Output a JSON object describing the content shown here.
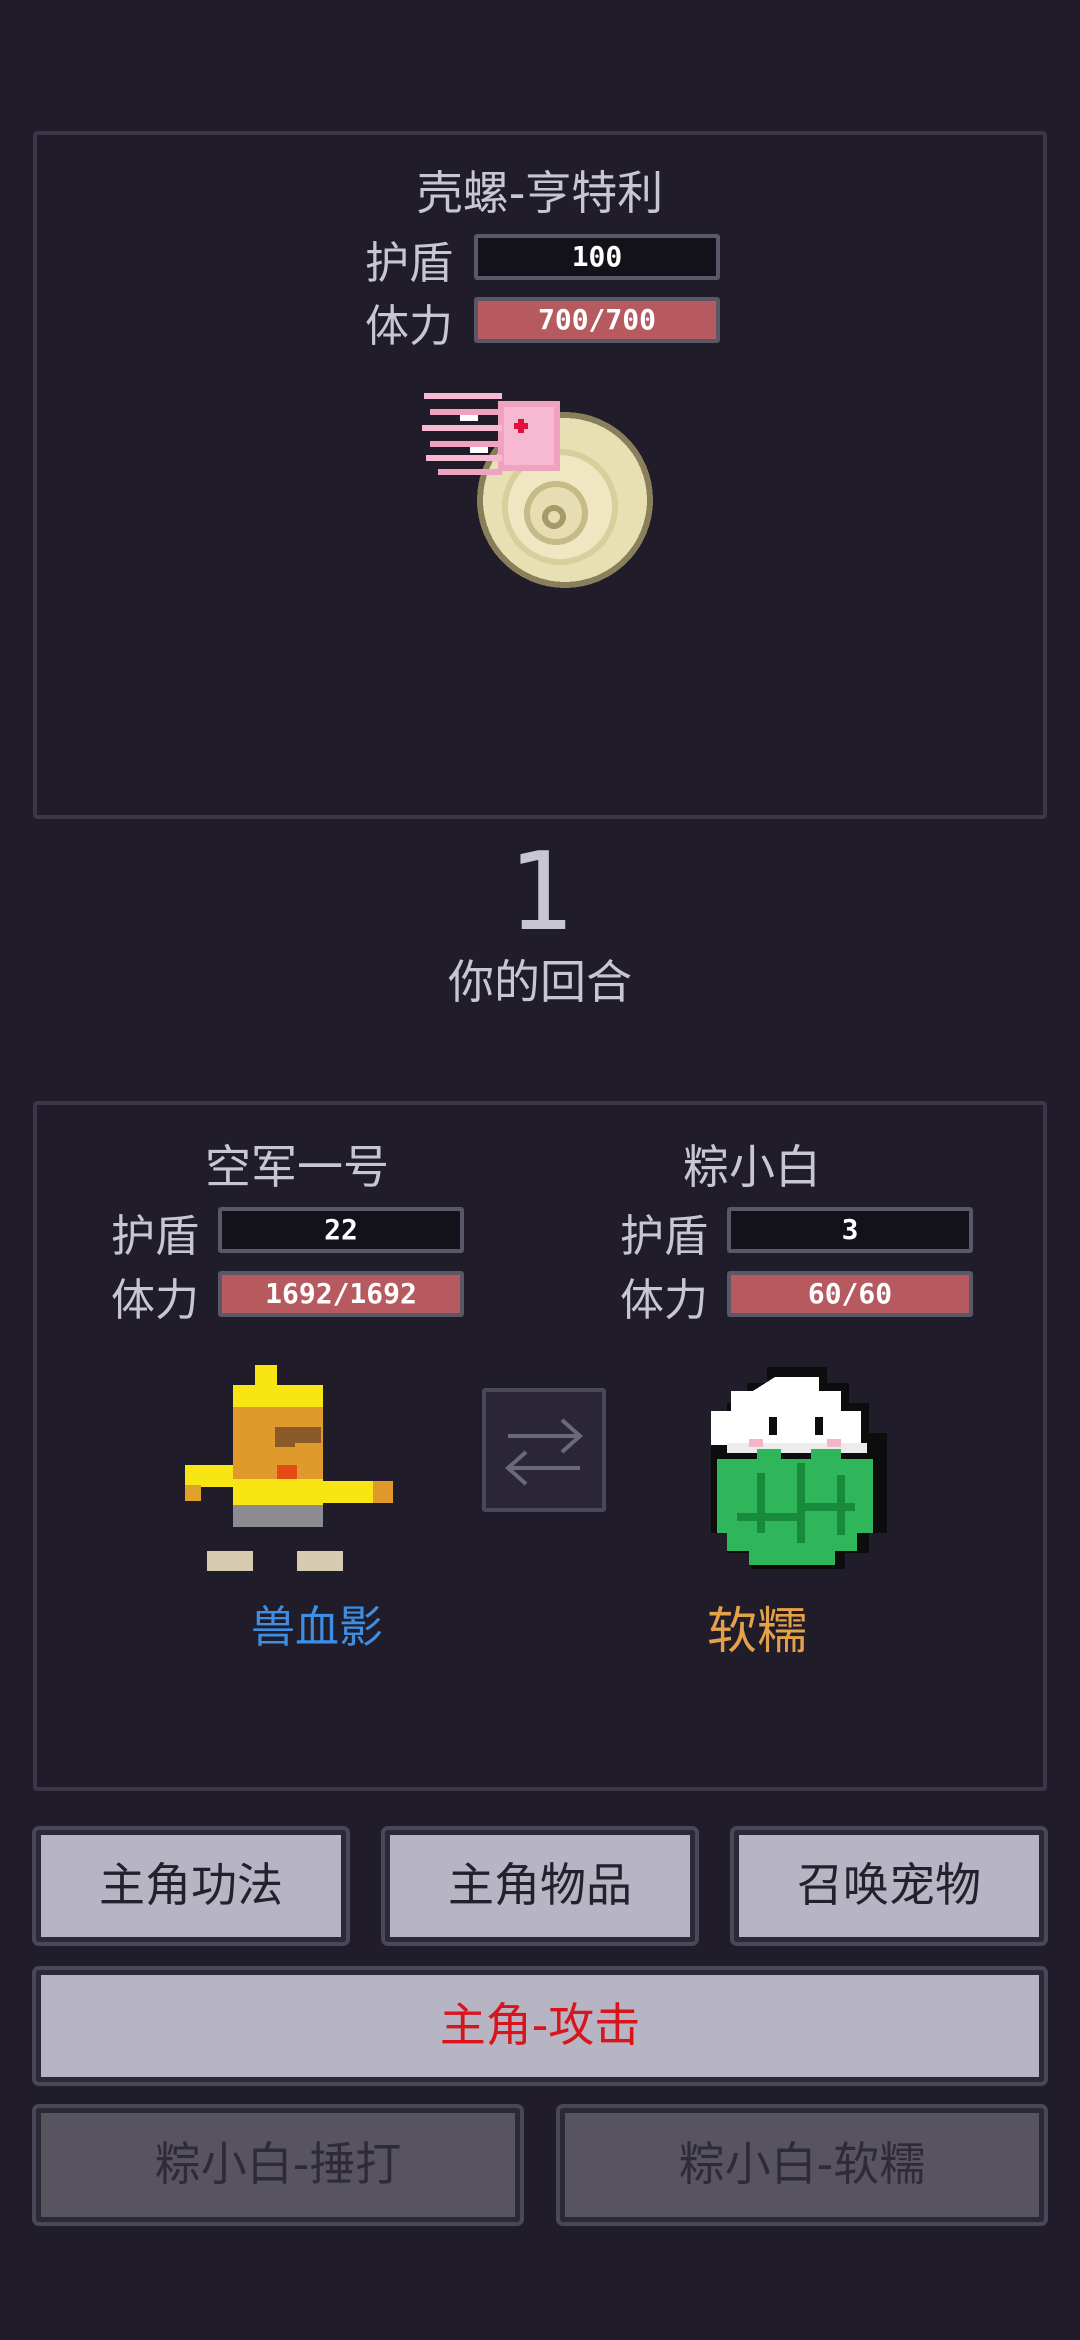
{
  "enemy": {
    "name": "壳螺-亨特利",
    "shield_label": "护盾",
    "shield_value": "100",
    "hp_label": "体力",
    "hp_text": "700/700",
    "hp_fraction": 1.0
  },
  "turn": {
    "number": "1",
    "label": "你的回合"
  },
  "hero": {
    "name": "空军一号",
    "shield_label": "护盾",
    "shield_value": "22",
    "hp_label": "体力",
    "hp_text": "1692/1692",
    "hp_fraction": 1.0,
    "skill": "兽血影",
    "skill_color": "#3e8ee3"
  },
  "pet": {
    "name": "粽小白",
    "shield_label": "护盾",
    "shield_value": "3",
    "hp_label": "体力",
    "hp_text": "60/60",
    "hp_fraction": 1.0,
    "skill": "软糯",
    "skill_color": "#e3a24a"
  },
  "swap_icon": "swap-arrows-icon",
  "actions": {
    "hero_skills": "主角功法",
    "hero_items": "主角物品",
    "summon_pet": "召唤宠物",
    "hero_attack": "主角-攻击",
    "hero_attack_color": "#d8141d",
    "pet_hit": "粽小白-捶打",
    "pet_soft": "粽小白-软糯"
  },
  "colors": {
    "background": "#201c29",
    "hp_bar": "#b75a60",
    "shield_bar": "#13111a"
  }
}
